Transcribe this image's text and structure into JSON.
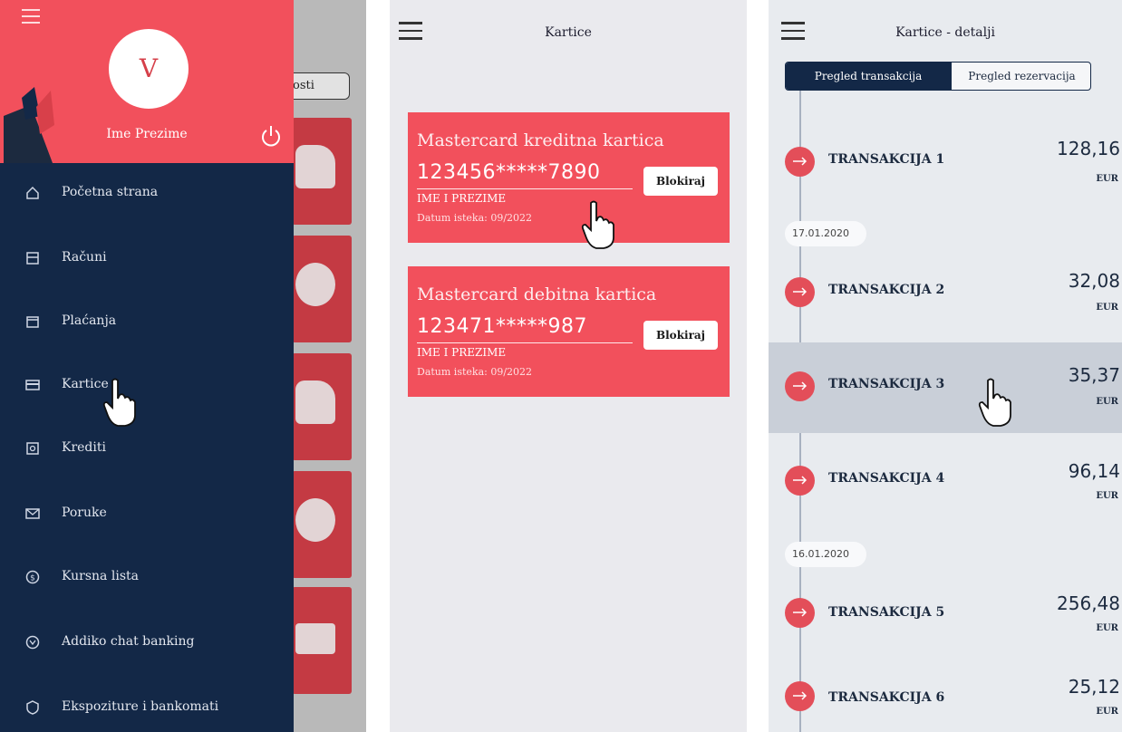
{
  "screen1": {
    "background_label": "osti",
    "avatar_initial": "V",
    "profile_name": "Ime Prezime",
    "menu": [
      {
        "label": "Početna strana",
        "icon": "home-icon"
      },
      {
        "label": "Računi",
        "icon": "accounts-icon"
      },
      {
        "label": "Plaćanja",
        "icon": "payments-icon"
      },
      {
        "label": "Kartice",
        "icon": "card-icon"
      },
      {
        "label": "Krediti",
        "icon": "loan-icon"
      },
      {
        "label": "Poruke",
        "icon": "mail-icon"
      },
      {
        "label": "Kursna lista",
        "icon": "currency-icon"
      },
      {
        "label": "Addiko chat banking",
        "icon": "chat-icon"
      },
      {
        "label": "Ekspoziture i bankomati",
        "icon": "location-icon"
      }
    ]
  },
  "screen2": {
    "title": "Kartice",
    "cards": [
      {
        "title": "Mastercard kreditna kartica",
        "number": "123456*****7890",
        "holder": "IME I PREZIME",
        "expiry": "Datum isteka: 09/2022",
        "button": "Blokiraj"
      },
      {
        "title": "Mastercard debitna kartica",
        "number": "123471*****987",
        "holder": "IME I PREZIME",
        "expiry": "Datum isteka: 09/2022",
        "button": "Blokiraj"
      }
    ]
  },
  "screen3": {
    "title": "Kartice - detalji",
    "tabs": {
      "active": "Pregled transakcija",
      "inactive": "Pregled rezervacija"
    },
    "dates": [
      "17.01.2020",
      "16.01.2020"
    ],
    "transactions": [
      {
        "name": "TRANSAKCIJA 1",
        "amount": "128,16",
        "currency": "EUR"
      },
      {
        "name": "TRANSAKCIJA 2",
        "amount": "32,08",
        "currency": "EUR"
      },
      {
        "name": "TRANSAKCIJA 3",
        "amount": "35,37",
        "currency": "EUR"
      },
      {
        "name": "TRANSAKCIJA 4",
        "amount": "96,14",
        "currency": "EUR"
      },
      {
        "name": "TRANSAKCIJA 5",
        "amount": "256,48",
        "currency": "EUR"
      },
      {
        "name": "TRANSAKCIJA 6",
        "amount": "25,12",
        "currency": "EUR"
      }
    ]
  },
  "colors": {
    "accent_red": "#f2505c",
    "navy": "#132847"
  }
}
